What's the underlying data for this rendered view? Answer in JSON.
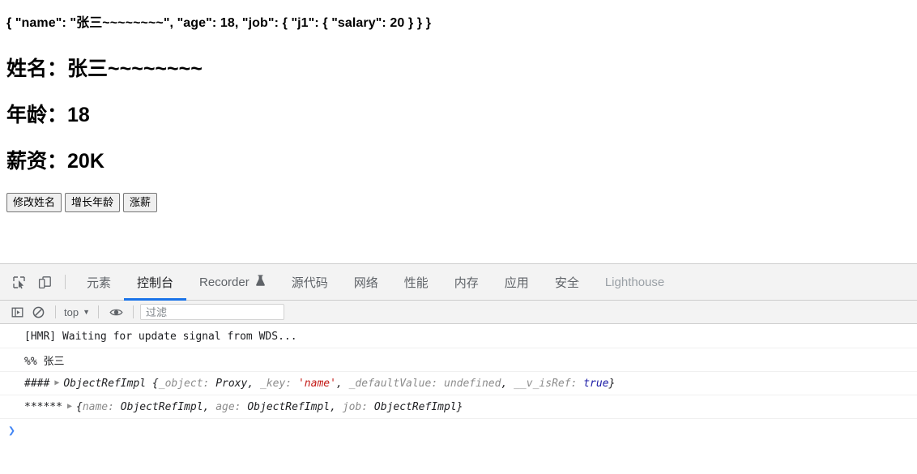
{
  "page": {
    "json_line": "{ \"name\": \"张三~~~~~~~~\", \"age\": 18, \"job\": { \"j1\": { \"salary\": 20 } } }",
    "headings": [
      {
        "label": "姓名：",
        "value": "张三~~~~~~~~"
      },
      {
        "label": "年龄：",
        "value": "18"
      },
      {
        "label": "薪资：",
        "value": "20K"
      }
    ],
    "buttons": [
      {
        "label": "修改姓名"
      },
      {
        "label": "增长年龄"
      },
      {
        "label": "涨薪"
      }
    ]
  },
  "devtools": {
    "toolbar_icons": [
      {
        "name": "inspect-element-icon"
      },
      {
        "name": "device-toolbar-icon"
      }
    ],
    "tabs": [
      {
        "label": "元素",
        "active": false,
        "icon": ""
      },
      {
        "label": "控制台",
        "active": true,
        "icon": ""
      },
      {
        "label": "Recorder",
        "active": false,
        "icon": "flask-icon"
      },
      {
        "label": "源代码",
        "active": false,
        "icon": ""
      },
      {
        "label": "网络",
        "active": false,
        "icon": ""
      },
      {
        "label": "性能",
        "active": false,
        "icon": ""
      },
      {
        "label": "内存",
        "active": false,
        "icon": ""
      },
      {
        "label": "应用",
        "active": false,
        "icon": ""
      },
      {
        "label": "安全",
        "active": false,
        "icon": ""
      },
      {
        "label": "Lighthouse",
        "active": false,
        "icon": ""
      }
    ],
    "console_toolbar": {
      "sidebar_toggle_icon": "console-sidebar-icon",
      "clear_icon": "clear-console-icon",
      "context": "top",
      "context_chevron": "▼",
      "eye_icon": "live-expression-eye-icon",
      "filter_placeholder": "过滤",
      "filter_value": ""
    },
    "messages": [
      {
        "id": "msg-hmr",
        "text": "[HMR] Waiting for update signal from WDS..."
      },
      {
        "id": "msg-name",
        "text": "%% 张三"
      },
      {
        "id": "msg-ref",
        "prefix": "####",
        "expandable": true,
        "object_name": "ObjectRefImpl",
        "open_brace": " {",
        "parts": [
          {
            "key": "_object: ",
            "value": "Proxy",
            "kind": "objname"
          },
          {
            "key": "_key: ",
            "value": "'name'",
            "kind": "str"
          },
          {
            "key": "_defaultValue: ",
            "value": "undefined",
            "kind": "undef"
          },
          {
            "key": "__v_isRef: ",
            "value": "true",
            "kind": "bool"
          }
        ],
        "close_brace": "}"
      },
      {
        "id": "msg-obj",
        "prefix": "******",
        "expandable": true,
        "open_brace": "{",
        "parts": [
          {
            "key": "name: ",
            "value": "ObjectRefImpl",
            "kind": "objname"
          },
          {
            "key": "age: ",
            "value": "ObjectRefImpl",
            "kind": "objname"
          },
          {
            "key": "job: ",
            "value": "ObjectRefImpl",
            "kind": "objname"
          }
        ],
        "close_brace": "}"
      }
    ],
    "prompt": {
      "caret": "❯",
      "value": ""
    }
  },
  "colors": {
    "accent_blue": "#1a73e8",
    "prompt_blue": "#4285f4",
    "string_red": "#c41a16",
    "boolean_blue": "#1a1aa6",
    "muted_gray": "#8c8c8c",
    "toolbar_bg": "#f3f3f3"
  }
}
